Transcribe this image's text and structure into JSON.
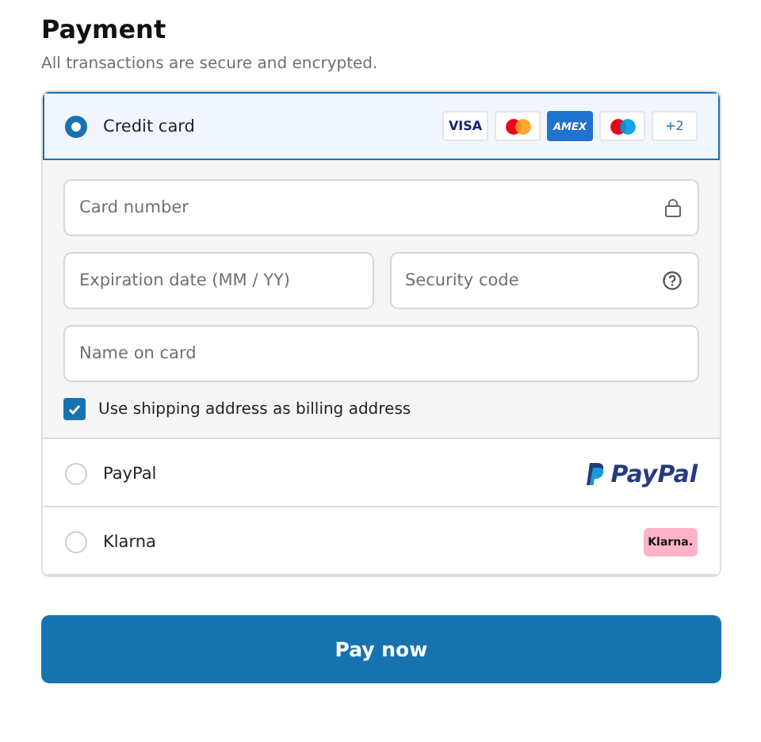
{
  "title": "Payment",
  "subtitle": "All transactions are secure and encrypted.",
  "methods": [
    {
      "kind": "card",
      "label": "Credit card",
      "selected": true,
      "badges": [
        {
          "kind": "visa",
          "text": "VISA"
        },
        {
          "kind": "mastercard"
        },
        {
          "kind": "amex",
          "text": "AMEX"
        },
        {
          "kind": "maestro"
        },
        {
          "kind": "more",
          "text": "+2"
        }
      ],
      "fields": [
        {
          "placeholder": "Card number"
        },
        {
          "placeholder": "Expiration date (MM / YY)"
        },
        {
          "placeholder": "Security code"
        },
        {
          "placeholder": "Name on card"
        }
      ],
      "billing": {
        "label": "Use shipping address as billing address",
        "checked": true
      }
    },
    {
      "kind": "paypal",
      "label": "PayPal",
      "selected": false,
      "logo": "PayPal"
    },
    {
      "kind": "klarna",
      "label": "Klarna",
      "selected": false,
      "logo": "Klarna."
    }
  ],
  "button": "Pay now"
}
